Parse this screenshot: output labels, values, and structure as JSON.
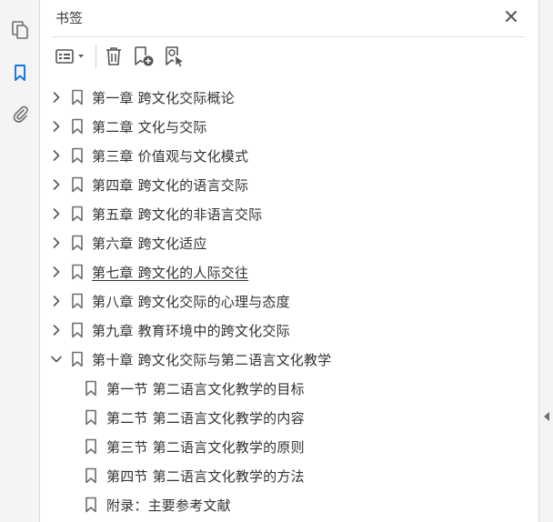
{
  "rail": {
    "items": [
      {
        "name": "page-thumbnails",
        "icon": "pages-icon",
        "active": false
      },
      {
        "name": "bookmarks",
        "icon": "bookmark-icon",
        "active": true
      },
      {
        "name": "attachments",
        "icon": "paperclip-icon",
        "active": false
      }
    ]
  },
  "panel": {
    "title": "书签",
    "close_icon": "close-icon"
  },
  "toolbar": {
    "options_icon": "options-menu-icon",
    "delete_icon": "trash-icon",
    "new_bookmark_icon": "add-bookmark-icon",
    "new_from_selection_icon": "bookmark-from-selection-icon"
  },
  "colors": {
    "accent": "#1473e6",
    "icon": "#6e6e6e",
    "text": "#333333"
  },
  "bookmarks": [
    {
      "label": "第一章  跨文化交际概论",
      "expanded": false,
      "level": 0
    },
    {
      "label": "第二章  文化与交际",
      "expanded": false,
      "level": 0
    },
    {
      "label": "第三章  价值观与文化模式",
      "expanded": false,
      "level": 0
    },
    {
      "label": "第四章  跨文化的语言交际",
      "expanded": false,
      "level": 0
    },
    {
      "label": "第五章  跨文化的非语言交际",
      "expanded": false,
      "level": 0
    },
    {
      "label": "第六章  跨文化适应",
      "expanded": false,
      "level": 0
    },
    {
      "label": "第七章  跨文化的人际交往",
      "expanded": false,
      "level": 0,
      "hovered": true
    },
    {
      "label": "第八章  跨文化交际的心理与态度",
      "expanded": false,
      "level": 0
    },
    {
      "label": "第九章  教育环境中的跨文化交际",
      "expanded": false,
      "level": 0
    },
    {
      "label": "第十章  跨文化交际与第二语言文化教学",
      "expanded": true,
      "level": 0
    },
    {
      "label": "第一节  第二语言文化教学的目标",
      "level": 1
    },
    {
      "label": "第二节  第二语言文化教学的内容",
      "level": 1
    },
    {
      "label": "第三节  第二语言文化教学的原则",
      "level": 1
    },
    {
      "label": "第四节  第二语言文化教学的方法",
      "level": 1
    },
    {
      "label": "附录：主要参考文献",
      "level": 1
    }
  ]
}
